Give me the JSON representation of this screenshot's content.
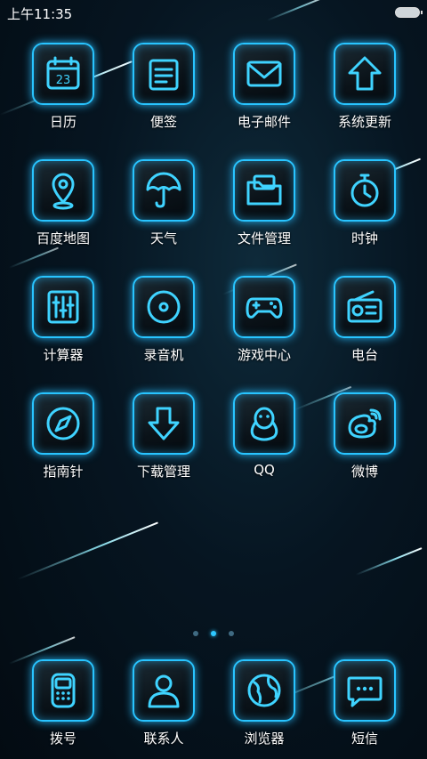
{
  "status": {
    "time": "上午11:35"
  },
  "apps": [
    {
      "label": "日历",
      "icon": "calendar-icon"
    },
    {
      "label": "便签",
      "icon": "notes-icon"
    },
    {
      "label": "电子邮件",
      "icon": "mail-icon"
    },
    {
      "label": "系统更新",
      "icon": "update-arrow-icon"
    },
    {
      "label": "百度地图",
      "icon": "map-pin-icon"
    },
    {
      "label": "天气",
      "icon": "umbrella-icon"
    },
    {
      "label": "文件管理",
      "icon": "folder-icon"
    },
    {
      "label": "时钟",
      "icon": "stopwatch-icon"
    },
    {
      "label": "计算器",
      "icon": "calculator-icon"
    },
    {
      "label": "录音机",
      "icon": "recorder-icon"
    },
    {
      "label": "游戏中心",
      "icon": "gamepad-icon"
    },
    {
      "label": "电台",
      "icon": "radio-icon"
    },
    {
      "label": "指南针",
      "icon": "compass-icon"
    },
    {
      "label": "下载管理",
      "icon": "download-icon"
    },
    {
      "label": "QQ",
      "icon": "qq-penguin-icon"
    },
    {
      "label": "微博",
      "icon": "weibo-icon"
    }
  ],
  "calendar_day": "23",
  "dock": [
    {
      "label": "拨号",
      "icon": "phone-icon"
    },
    {
      "label": "联系人",
      "icon": "contacts-icon"
    },
    {
      "label": "浏览器",
      "icon": "browser-globe-icon"
    },
    {
      "label": "短信",
      "icon": "message-icon"
    }
  ],
  "pager": {
    "count": 3,
    "active": 2
  },
  "colors": {
    "accent": "#28c4ff",
    "background": "#061521"
  }
}
